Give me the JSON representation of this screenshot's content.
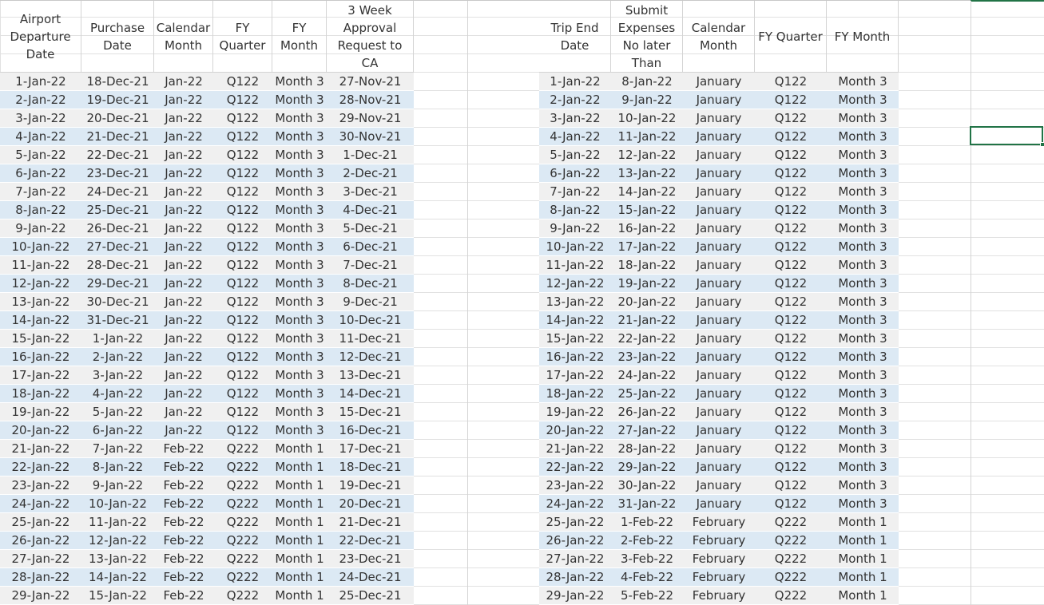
{
  "app": {
    "name": "Excel",
    "accent": "#217346",
    "row_band_colors": [
      "#f0f0f0",
      "#dce9f4"
    ]
  },
  "left_table": {
    "headers": [
      "Airport\nDeparture\nDate",
      "Purchase\nDate",
      "Calendar\nMonth",
      "FY\nQuarter",
      "FY\nMonth",
      "3 Week\nApproval\nRequest to CA"
    ],
    "rows": [
      [
        "1-Jan-22",
        "18-Dec-21",
        "Jan-22",
        "Q122",
        "Month 3",
        "27-Nov-21"
      ],
      [
        "2-Jan-22",
        "19-Dec-21",
        "Jan-22",
        "Q122",
        "Month 3",
        "28-Nov-21"
      ],
      [
        "3-Jan-22",
        "20-Dec-21",
        "Jan-22",
        "Q122",
        "Month 3",
        "29-Nov-21"
      ],
      [
        "4-Jan-22",
        "21-Dec-21",
        "Jan-22",
        "Q122",
        "Month 3",
        "30-Nov-21"
      ],
      [
        "5-Jan-22",
        "22-Dec-21",
        "Jan-22",
        "Q122",
        "Month 3",
        "1-Dec-21"
      ],
      [
        "6-Jan-22",
        "23-Dec-21",
        "Jan-22",
        "Q122",
        "Month 3",
        "2-Dec-21"
      ],
      [
        "7-Jan-22",
        "24-Dec-21",
        "Jan-22",
        "Q122",
        "Month 3",
        "3-Dec-21"
      ],
      [
        "8-Jan-22",
        "25-Dec-21",
        "Jan-22",
        "Q122",
        "Month 3",
        "4-Dec-21"
      ],
      [
        "9-Jan-22",
        "26-Dec-21",
        "Jan-22",
        "Q122",
        "Month 3",
        "5-Dec-21"
      ],
      [
        "10-Jan-22",
        "27-Dec-21",
        "Jan-22",
        "Q122",
        "Month 3",
        "6-Dec-21"
      ],
      [
        "11-Jan-22",
        "28-Dec-21",
        "Jan-22",
        "Q122",
        "Month 3",
        "7-Dec-21"
      ],
      [
        "12-Jan-22",
        "29-Dec-21",
        "Jan-22",
        "Q122",
        "Month 3",
        "8-Dec-21"
      ],
      [
        "13-Jan-22",
        "30-Dec-21",
        "Jan-22",
        "Q122",
        "Month 3",
        "9-Dec-21"
      ],
      [
        "14-Jan-22",
        "31-Dec-21",
        "Jan-22",
        "Q122",
        "Month 3",
        "10-Dec-21"
      ],
      [
        "15-Jan-22",
        "1-Jan-22",
        "Jan-22",
        "Q122",
        "Month 3",
        "11-Dec-21"
      ],
      [
        "16-Jan-22",
        "2-Jan-22",
        "Jan-22",
        "Q122",
        "Month 3",
        "12-Dec-21"
      ],
      [
        "17-Jan-22",
        "3-Jan-22",
        "Jan-22",
        "Q122",
        "Month 3",
        "13-Dec-21"
      ],
      [
        "18-Jan-22",
        "4-Jan-22",
        "Jan-22",
        "Q122",
        "Month 3",
        "14-Dec-21"
      ],
      [
        "19-Jan-22",
        "5-Jan-22",
        "Jan-22",
        "Q122",
        "Month 3",
        "15-Dec-21"
      ],
      [
        "20-Jan-22",
        "6-Jan-22",
        "Jan-22",
        "Q122",
        "Month 3",
        "16-Dec-21"
      ],
      [
        "21-Jan-22",
        "7-Jan-22",
        "Feb-22",
        "Q222",
        "Month 1",
        "17-Dec-21"
      ],
      [
        "22-Jan-22",
        "8-Jan-22",
        "Feb-22",
        "Q222",
        "Month 1",
        "18-Dec-21"
      ],
      [
        "23-Jan-22",
        "9-Jan-22",
        "Feb-22",
        "Q222",
        "Month 1",
        "19-Dec-21"
      ],
      [
        "24-Jan-22",
        "10-Jan-22",
        "Feb-22",
        "Q222",
        "Month 1",
        "20-Dec-21"
      ],
      [
        "25-Jan-22",
        "11-Jan-22",
        "Feb-22",
        "Q222",
        "Month 1",
        "21-Dec-21"
      ],
      [
        "26-Jan-22",
        "12-Jan-22",
        "Feb-22",
        "Q222",
        "Month 1",
        "22-Dec-21"
      ],
      [
        "27-Jan-22",
        "13-Jan-22",
        "Feb-22",
        "Q222",
        "Month 1",
        "23-Dec-21"
      ],
      [
        "28-Jan-22",
        "14-Jan-22",
        "Feb-22",
        "Q222",
        "Month 1",
        "24-Dec-21"
      ],
      [
        "29-Jan-22",
        "15-Jan-22",
        "Feb-22",
        "Q222",
        "Month 1",
        "25-Dec-21"
      ]
    ]
  },
  "right_table": {
    "headers": [
      "Trip End\nDate",
      "Submit\nExpenses\nNo later\nThan",
      "Calendar\nMonth",
      "FY Quarter",
      "FY Month"
    ],
    "rows": [
      [
        "1-Jan-22",
        "8-Jan-22",
        "January",
        "Q122",
        "Month 3"
      ],
      [
        "2-Jan-22",
        "9-Jan-22",
        "January",
        "Q122",
        "Month 3"
      ],
      [
        "3-Jan-22",
        "10-Jan-22",
        "January",
        "Q122",
        "Month 3"
      ],
      [
        "4-Jan-22",
        "11-Jan-22",
        "January",
        "Q122",
        "Month 3"
      ],
      [
        "5-Jan-22",
        "12-Jan-22",
        "January",
        "Q122",
        "Month 3"
      ],
      [
        "6-Jan-22",
        "13-Jan-22",
        "January",
        "Q122",
        "Month 3"
      ],
      [
        "7-Jan-22",
        "14-Jan-22",
        "January",
        "Q122",
        "Month 3"
      ],
      [
        "8-Jan-22",
        "15-Jan-22",
        "January",
        "Q122",
        "Month 3"
      ],
      [
        "9-Jan-22",
        "16-Jan-22",
        "January",
        "Q122",
        "Month 3"
      ],
      [
        "10-Jan-22",
        "17-Jan-22",
        "January",
        "Q122",
        "Month 3"
      ],
      [
        "11-Jan-22",
        "18-Jan-22",
        "January",
        "Q122",
        "Month 3"
      ],
      [
        "12-Jan-22",
        "19-Jan-22",
        "January",
        "Q122",
        "Month 3"
      ],
      [
        "13-Jan-22",
        "20-Jan-22",
        "January",
        "Q122",
        "Month 3"
      ],
      [
        "14-Jan-22",
        "21-Jan-22",
        "January",
        "Q122",
        "Month 3"
      ],
      [
        "15-Jan-22",
        "22-Jan-22",
        "January",
        "Q122",
        "Month 3"
      ],
      [
        "16-Jan-22",
        "23-Jan-22",
        "January",
        "Q122",
        "Month 3"
      ],
      [
        "17-Jan-22",
        "24-Jan-22",
        "January",
        "Q122",
        "Month 3"
      ],
      [
        "18-Jan-22",
        "25-Jan-22",
        "January",
        "Q122",
        "Month 3"
      ],
      [
        "19-Jan-22",
        "26-Jan-22",
        "January",
        "Q122",
        "Month 3"
      ],
      [
        "20-Jan-22",
        "27-Jan-22",
        "January",
        "Q122",
        "Month 3"
      ],
      [
        "21-Jan-22",
        "28-Jan-22",
        "January",
        "Q122",
        "Month 3"
      ],
      [
        "22-Jan-22",
        "29-Jan-22",
        "January",
        "Q122",
        "Month 3"
      ],
      [
        "23-Jan-22",
        "30-Jan-22",
        "January",
        "Q122",
        "Month 3"
      ],
      [
        "24-Jan-22",
        "31-Jan-22",
        "January",
        "Q122",
        "Month 3"
      ],
      [
        "25-Jan-22",
        "1-Feb-22",
        "February",
        "Q222",
        "Month 1"
      ],
      [
        "26-Jan-22",
        "2-Feb-22",
        "February",
        "Q222",
        "Month 1"
      ],
      [
        "27-Jan-22",
        "3-Feb-22",
        "February",
        "Q222",
        "Month 1"
      ],
      [
        "28-Jan-22",
        "4-Feb-22",
        "February",
        "Q222",
        "Month 1"
      ],
      [
        "29-Jan-22",
        "5-Feb-22",
        "February",
        "Q222",
        "Month 1"
      ]
    ]
  }
}
